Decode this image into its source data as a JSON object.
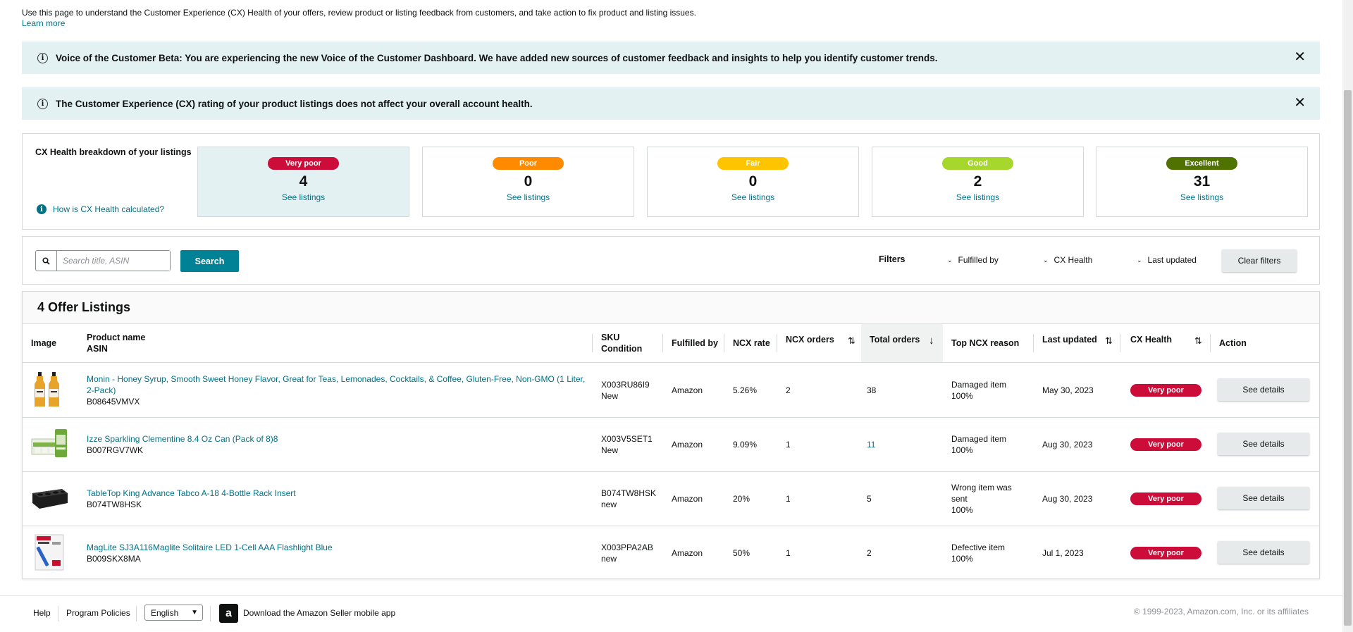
{
  "intro": {
    "text": "Use this page to understand the Customer Experience (CX) Health of your offers, review product or listing feedback from customers, and take action to fix product and listing issues.",
    "learn_more": "Learn more"
  },
  "banners": [
    {
      "text": "Voice of the Customer Beta: You are experiencing the new Voice of the Customer Dashboard. We have added new sources of customer feedback and insights to help you identify customer trends.",
      "close": "✕"
    },
    {
      "text": "The Customer Experience (CX) rating of your product listings does not affect your overall account health.",
      "close": "✕"
    }
  ],
  "breakdown": {
    "title": "CX Health breakdown of your listings",
    "help_link": "How is CX Health calculated?",
    "cards": [
      {
        "label": "Very poor",
        "count": "4",
        "link": "See listings",
        "color": "#cc0c39",
        "selected": true
      },
      {
        "label": "Poor",
        "count": "0",
        "link": "See listings",
        "color": "#ff8a00",
        "selected": false
      },
      {
        "label": "Fair",
        "count": "0",
        "link": "See listings",
        "color": "#ffc400",
        "selected": false
      },
      {
        "label": "Good",
        "count": "2",
        "link": "See listings",
        "color": "#a6d72d",
        "selected": false
      },
      {
        "label": "Excellent",
        "count": "31",
        "link": "See listings",
        "color": "#507200",
        "selected": false
      }
    ]
  },
  "search": {
    "placeholder": "Search title, ASIN",
    "button": "Search"
  },
  "filters": {
    "label": "Filters",
    "dropdowns": [
      "Fulfilled by",
      "CX Health",
      "Last updated"
    ],
    "clear": "Clear filters"
  },
  "table": {
    "title": "4 Offer Listings",
    "headers": {
      "image": "Image",
      "product_name": "Product name",
      "asin": "ASIN",
      "sku": "SKU",
      "condition": "Condition",
      "fulfilled_by": "Fulfilled by",
      "ncx_rate": "NCX rate",
      "ncx_orders": "NCX orders",
      "total_orders": "Total orders",
      "top_reason": "Top NCX reason",
      "last_updated": "Last updated",
      "cx_health": "CX Health",
      "action": "Action"
    },
    "rows": [
      {
        "product": "Monin - Honey Syrup, Smooth Sweet Honey Flavor, Great for Teas, Lemonades, Cocktails, & Coffee, Gluten-Free, Non-GMO (1 Liter, 2-Pack)",
        "asin": "B08645VMVX",
        "sku": "X003RU86I9",
        "condition": "New",
        "fulfilled": "Amazon",
        "rate": "5.26%",
        "ncx": "2",
        "total": "38",
        "reason": "Damaged item",
        "reason_pct": "100%",
        "updated": "May 30, 2023",
        "health": "Very poor",
        "action": "See details",
        "image": "honey-syrup-bottles"
      },
      {
        "product": "Izze Sparkling Clementine 8.4 Oz Can (Pack of 8)8",
        "asin": "B007RGV7WK",
        "sku": "X003V5SET1",
        "condition": "New",
        "fulfilled": "Amazon",
        "rate": "9.09%",
        "ncx": "1",
        "total": "11",
        "reason": "Damaged item",
        "reason_pct": "100%",
        "updated": "Aug 30, 2023",
        "health": "Very poor",
        "action": "See details",
        "image": "izze-cans"
      },
      {
        "product": "TableTop King Advance Tabco A-18 4-Bottle Rack Insert",
        "asin": "B074TW8HSK",
        "sku": "B074TW8HSK",
        "condition": "new",
        "fulfilled": "Amazon",
        "rate": "20%",
        "ncx": "1",
        "total": "5",
        "reason": "Wrong item was sent",
        "reason_pct": "100%",
        "updated": "Aug 30, 2023",
        "health": "Very poor",
        "action": "See details",
        "image": "bottle-rack"
      },
      {
        "product": "MagLite SJ3A116Maglite Solitaire LED 1-Cell AAA Flashlight Blue",
        "asin": "B009SKX8MA",
        "sku": "X003PPA2AB",
        "condition": "new",
        "fulfilled": "Amazon",
        "rate": "50%",
        "ncx": "1",
        "total": "2",
        "reason": "Defective item",
        "reason_pct": "100%",
        "updated": "Jul 1, 2023",
        "health": "Very poor",
        "action": "See details",
        "image": "maglite-package"
      }
    ]
  },
  "footer": {
    "help": "Help",
    "policies": "Program Policies",
    "language": "English",
    "app_text": "Download the Amazon Seller mobile app",
    "app_logo": "a",
    "copyright": "© 1999-2023, Amazon.com, Inc. or its affiliates"
  }
}
